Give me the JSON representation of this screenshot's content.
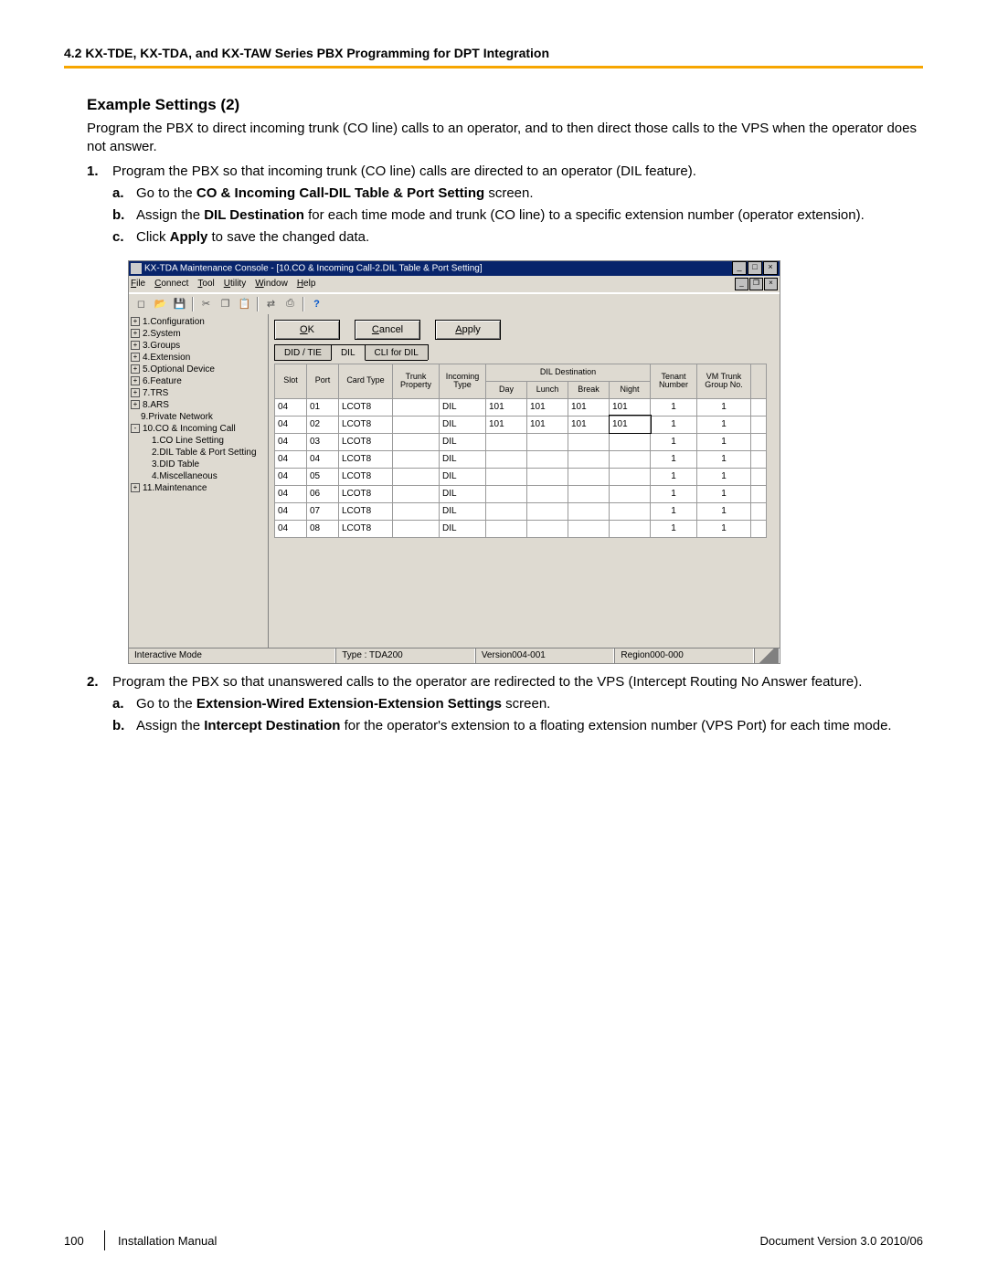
{
  "header": "4.2 KX-TDE, KX-TDA, and KX-TAW Series PBX Programming for DPT Integration",
  "section_title": "Example Settings (2)",
  "intro": "Program the PBX to direct incoming trunk (CO line) calls to an operator, and to then direct those calls to the VPS when the operator does not answer.",
  "step1_text": "Program the PBX so that incoming trunk (CO line) calls are directed to an operator (DIL feature).",
  "step1a_pre": "Go to the ",
  "step1a_bold": "CO & Incoming Call-DIL Table & Port Setting",
  "step1a_post": " screen.",
  "step1b_pre": "Assign the ",
  "step1b_bold": "DIL Destination",
  "step1b_post": " for each time mode and trunk (CO line) to a specific extension number (operator extension).",
  "step1c_pre": "Click ",
  "step1c_bold": "Apply",
  "step1c_post": " to save the changed data.",
  "step2_text": "Program the PBX so that unanswered calls to the operator are redirected to the VPS (Intercept Routing No Answer feature).",
  "step2a_pre": "Go to the ",
  "step2a_bold": "Extension-Wired Extension-Extension Settings",
  "step2a_post": " screen.",
  "step2b_pre": "Assign the ",
  "step2b_bold": "Intercept Destination",
  "step2b_post": " for the operator's extension to a floating extension number (VPS Port) for each time mode.",
  "screenshot": {
    "title": "KX-TDA Maintenance Console - [10.CO & Incoming Call-2.DIL Table & Port Setting]",
    "menus": {
      "file": "File",
      "connect": "Connect",
      "tool": "Tool",
      "utility": "Utility",
      "window": "Window",
      "help": "Help"
    },
    "buttons": {
      "ok": "OK",
      "cancel": "Cancel",
      "apply": "Apply"
    },
    "tabs": {
      "t1": "DID / TIE",
      "t2": "DIL",
      "t3": "CLI for DIL"
    },
    "tree": [
      {
        "lvl": 0,
        "box": "+",
        "label": "1.Configuration"
      },
      {
        "lvl": 0,
        "box": "+",
        "label": "2.System"
      },
      {
        "lvl": 0,
        "box": "+",
        "label": "3.Groups"
      },
      {
        "lvl": 0,
        "box": "+",
        "label": "4.Extension"
      },
      {
        "lvl": 0,
        "box": "+",
        "label": "5.Optional Device"
      },
      {
        "lvl": 0,
        "box": "+",
        "label": "6.Feature"
      },
      {
        "lvl": 0,
        "box": "+",
        "label": "7.TRS"
      },
      {
        "lvl": 0,
        "box": "+",
        "label": "8.ARS"
      },
      {
        "lvl": 0,
        "box": "",
        "label": "9.Private Network"
      },
      {
        "lvl": 0,
        "box": "-",
        "label": "10.CO & Incoming Call"
      },
      {
        "lvl": 1,
        "box": "",
        "label": "1.CO Line Setting"
      },
      {
        "lvl": 1,
        "box": "",
        "label": "2.DIL Table & Port Setting"
      },
      {
        "lvl": 1,
        "box": "",
        "label": "3.DID Table"
      },
      {
        "lvl": 1,
        "box": "",
        "label": "4.Miscellaneous"
      },
      {
        "lvl": 0,
        "box": "+",
        "label": "11.Maintenance"
      }
    ],
    "columns": {
      "slot": "Slot",
      "port": "Port",
      "cardtype": "Card Type",
      "trunkprop": "Trunk\nProperty",
      "incoming": "Incoming\nType",
      "dil": "DIL Destination",
      "day": "Day",
      "lunch": "Lunch",
      "break": "Break",
      "night": "Night",
      "tenant": "Tenant\nNumber",
      "vm": "VM Trunk\nGroup No."
    },
    "rows": [
      {
        "slot": "04",
        "port": "01",
        "card": "LCOT8",
        "trunk": "",
        "inc": "DIL",
        "day": "101",
        "lunch": "101",
        "break": "101",
        "night": "101",
        "tenant": "1",
        "vm": "1",
        "edit": false
      },
      {
        "slot": "04",
        "port": "02",
        "card": "LCOT8",
        "trunk": "",
        "inc": "DIL",
        "day": "101",
        "lunch": "101",
        "break": "101",
        "night": "101",
        "tenant": "1",
        "vm": "1",
        "edit": true
      },
      {
        "slot": "04",
        "port": "03",
        "card": "LCOT8",
        "trunk": "",
        "inc": "DIL",
        "day": "",
        "lunch": "",
        "break": "",
        "night": "",
        "tenant": "1",
        "vm": "1",
        "edit": false
      },
      {
        "slot": "04",
        "port": "04",
        "card": "LCOT8",
        "trunk": "",
        "inc": "DIL",
        "day": "",
        "lunch": "",
        "break": "",
        "night": "",
        "tenant": "1",
        "vm": "1",
        "edit": false
      },
      {
        "slot": "04",
        "port": "05",
        "card": "LCOT8",
        "trunk": "",
        "inc": "DIL",
        "day": "",
        "lunch": "",
        "break": "",
        "night": "",
        "tenant": "1",
        "vm": "1",
        "edit": false
      },
      {
        "slot": "04",
        "port": "06",
        "card": "LCOT8",
        "trunk": "",
        "inc": "DIL",
        "day": "",
        "lunch": "",
        "break": "",
        "night": "",
        "tenant": "1",
        "vm": "1",
        "edit": false
      },
      {
        "slot": "04",
        "port": "07",
        "card": "LCOT8",
        "trunk": "",
        "inc": "DIL",
        "day": "",
        "lunch": "",
        "break": "",
        "night": "",
        "tenant": "1",
        "vm": "1",
        "edit": false
      },
      {
        "slot": "04",
        "port": "08",
        "card": "LCOT8",
        "trunk": "",
        "inc": "DIL",
        "day": "",
        "lunch": "",
        "break": "",
        "night": "",
        "tenant": "1",
        "vm": "1",
        "edit": false
      }
    ],
    "status": {
      "mode": "Interactive Mode",
      "type": "Type : TDA200",
      "version": "Version004-001",
      "region": "Region000-000"
    }
  },
  "footer": {
    "page": "100",
    "manual": "Installation Manual",
    "docver": "Document Version  3.0  2010/06"
  }
}
